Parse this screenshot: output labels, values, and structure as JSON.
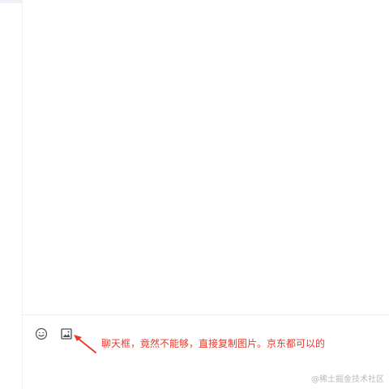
{
  "toolbar": {
    "emoji_icon": "smiley-icon",
    "image_icon": "image-icon"
  },
  "annotation": {
    "text": "聊天框，竟然不能够，直接复制图片。京东都可以的",
    "color": "#e8392d"
  },
  "watermark": {
    "text": "@稀土掘金技术社区"
  },
  "colors": {
    "border": "#e9ecf1",
    "icon": "#4a4f57",
    "annotation": "#e8392d",
    "watermark": "#b6b9bf"
  }
}
